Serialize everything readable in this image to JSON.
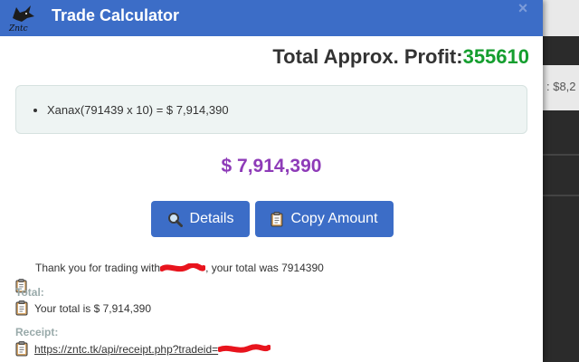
{
  "header": {
    "title": "Trade Calculator",
    "logo_text": "Zntc",
    "close_label": "×"
  },
  "profit": {
    "label": "Total Approx. Profit:",
    "value": "355610"
  },
  "items": [
    {
      "text": "Xanax(791439 x 10) =  $ 7,914,390"
    }
  ],
  "total_display": "$ 7,914,390",
  "buttons": {
    "details_label": "Details",
    "copy_label": "Copy Amount"
  },
  "thanks": {
    "prefix": "Thank you for trading with",
    "suffix": ", your total was 7914390"
  },
  "total_section": {
    "label": "Total:",
    "text": "Your total is $ 7,914,390"
  },
  "receipt_section": {
    "label": "Receipt:",
    "link_text": "https://zntc.tk/api/receipt.php?tradeid="
  },
  "background": {
    "partial_text": ": $8,2"
  },
  "colors": {
    "header_blue": "#3c6dc7",
    "profit_green": "#159e2f",
    "total_purple": "#8e3bb8",
    "redaction_red": "#e8141d"
  }
}
